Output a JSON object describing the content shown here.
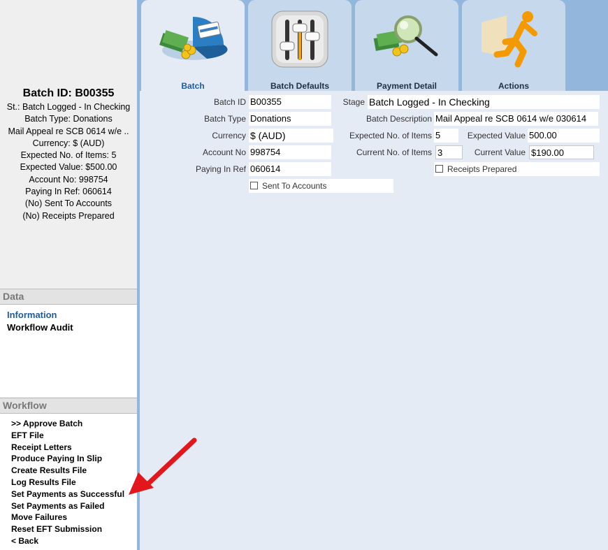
{
  "summary": {
    "title": "Batch ID: B00355",
    "lines": [
      "St.: Batch Logged - In Checking",
      "Batch Type: Donations",
      "Mail Appeal re SCB 0614 w/e ..",
      "Currency: $ (AUD)",
      "Expected No. of Items: 5",
      "Expected Value: $500.00",
      "Account No: 998754",
      "Paying In Ref: 060614",
      "(No) Sent To Accounts",
      "(No) Receipts Prepared"
    ]
  },
  "data_section": {
    "header": "Data",
    "items": [
      "Information",
      "Workflow Audit"
    ]
  },
  "workflow_section": {
    "header": "Workflow",
    "items": [
      ">> Approve Batch",
      "EFT File",
      "Receipt Letters",
      "Produce Paying In Slip",
      "Create Results File",
      "Log Results File",
      "Set Payments as Successful",
      "Set Payments as Failed",
      "Move Failures",
      "Reset EFT Submission",
      "< Back"
    ]
  },
  "tabs": [
    {
      "label": "Batch",
      "icon": "pie-chart-money-icon",
      "active": true
    },
    {
      "label": "Batch Defaults",
      "icon": "sliders-icon",
      "active": false
    },
    {
      "label": "Payment Detail",
      "icon": "magnifier-money-icon",
      "active": false
    },
    {
      "label": "Actions",
      "icon": "running-man-icon",
      "active": false
    }
  ],
  "form": {
    "batch_id": {
      "label": "Batch ID",
      "value": "B00355"
    },
    "batch_type": {
      "label": "Batch Type",
      "value": "Donations"
    },
    "currency": {
      "label": "Currency",
      "value": "$ (AUD)"
    },
    "account_no": {
      "label": "Account No",
      "value": "998754"
    },
    "paying_in_ref": {
      "label": "Paying In Ref",
      "value": "060614"
    },
    "sent_to_accounts": {
      "label": "Sent To Accounts",
      "checked": false
    },
    "stage": {
      "label": "Stage",
      "value": "Batch Logged - In Checking"
    },
    "batch_description": {
      "label": "Batch Description",
      "value": "Mail Appeal re SCB 0614 w/e 030614"
    },
    "expected_items": {
      "label": "Expected No. of Items",
      "value": "5"
    },
    "expected_value": {
      "label": "Expected Value",
      "value": "500.00"
    },
    "current_items": {
      "label": "Current No. of Items",
      "value": "3"
    },
    "current_value": {
      "label": "Current Value",
      "value": "$190.00"
    },
    "receipts_prepared": {
      "label": "Receipts Prepared",
      "checked": false
    }
  },
  "colors": {
    "accent": "#1e5a9c",
    "tab_bar": "#93b6dd",
    "tab_inactive": "#c5d8ec",
    "content_bg": "#e4ebf4",
    "arrow": "#e3161b"
  }
}
